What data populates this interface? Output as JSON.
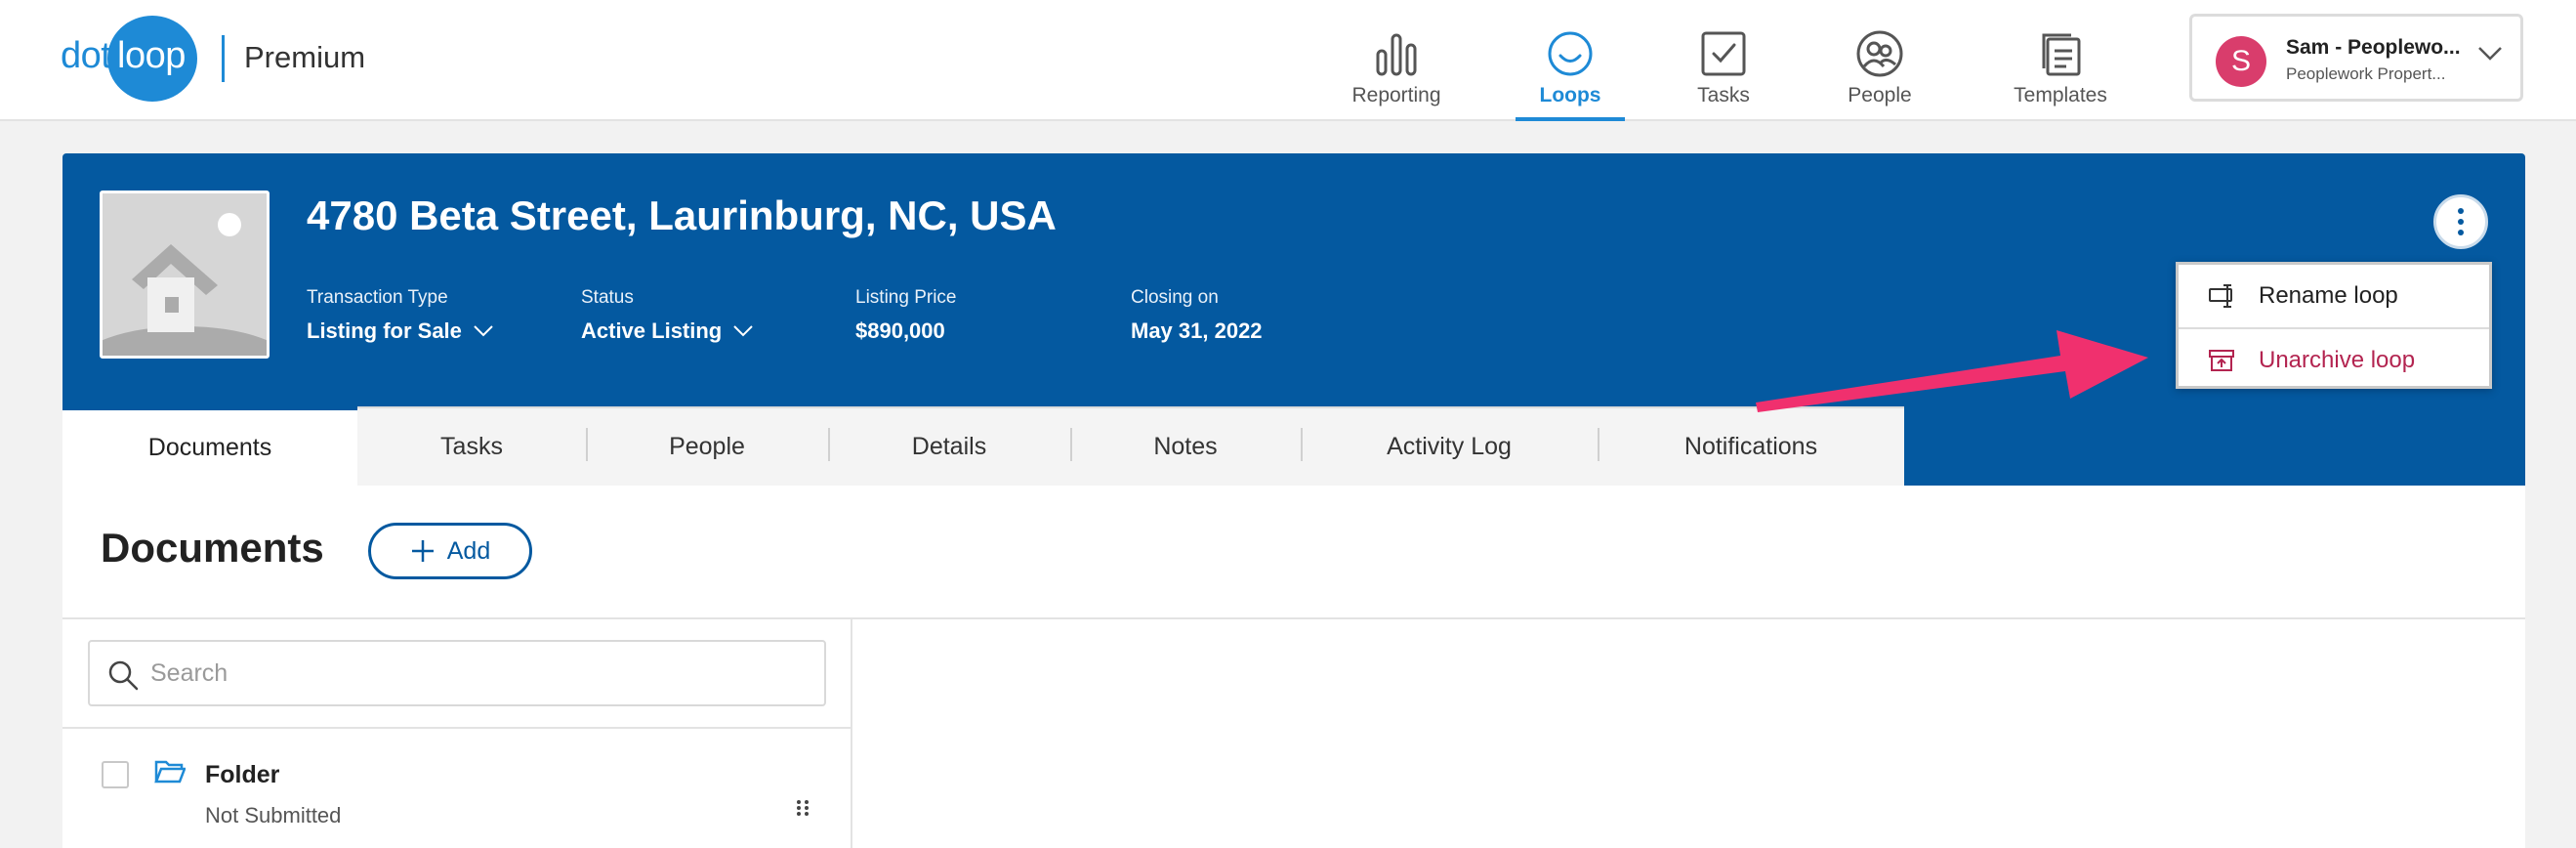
{
  "brand": {
    "logo_dot": "dot",
    "logo_loop": "loop",
    "plan": "Premium",
    "color": "#1e8ad6"
  },
  "nav": {
    "items": [
      {
        "label": "Reporting",
        "icon": "bar-chart-icon",
        "active": false
      },
      {
        "label": "Loops",
        "icon": "loops-icon",
        "active": true
      },
      {
        "label": "Tasks",
        "icon": "checkbox-icon",
        "active": false
      },
      {
        "label": "People",
        "icon": "people-icon",
        "active": false
      },
      {
        "label": "Templates",
        "icon": "templates-icon",
        "active": false
      }
    ]
  },
  "account": {
    "initial": "S",
    "name": "Sam - Peoplewo...",
    "org": "Peoplework Propert...",
    "avatar_color": "#d93d6c"
  },
  "loop": {
    "title": "4780 Beta Street, Laurinburg, NC, USA",
    "header_color": "#0459a0",
    "fields": [
      {
        "label": "Transaction Type",
        "value": "Listing for Sale",
        "dropdown": true
      },
      {
        "label": "Status",
        "value": "Active Listing",
        "dropdown": true
      },
      {
        "label": "Listing Price",
        "value": "$890,000",
        "dropdown": false
      },
      {
        "label": "Closing on",
        "value": "May 31, 2022",
        "dropdown": false
      }
    ]
  },
  "menu": {
    "items": [
      {
        "label": "Rename loop",
        "icon": "rename-icon"
      },
      {
        "label": "Unarchive loop",
        "icon": "unarchive-icon",
        "color": "#b32450"
      }
    ]
  },
  "tabs": [
    {
      "label": "Documents",
      "active": true
    },
    {
      "label": "Tasks"
    },
    {
      "label": "People"
    },
    {
      "label": "Details"
    },
    {
      "label": "Notes"
    },
    {
      "label": "Activity Log"
    },
    {
      "label": "Notifications"
    }
  ],
  "documents": {
    "title": "Documents",
    "add_label": "Add",
    "search_placeholder": "Search",
    "folders": [
      {
        "name": "Folder",
        "status": "Not Submitted"
      }
    ]
  },
  "annotation": {
    "arrow_color": "#f0306e"
  }
}
